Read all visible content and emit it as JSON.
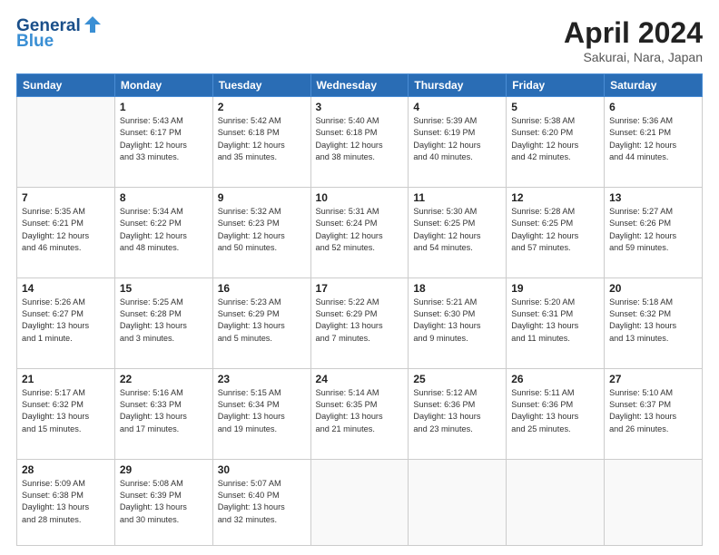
{
  "header": {
    "logo_line1": "General",
    "logo_line2": "Blue",
    "month": "April 2024",
    "location": "Sakurai, Nara, Japan"
  },
  "weekdays": [
    "Sunday",
    "Monday",
    "Tuesday",
    "Wednesday",
    "Thursday",
    "Friday",
    "Saturday"
  ],
  "weeks": [
    [
      {
        "day": "",
        "info": ""
      },
      {
        "day": "1",
        "info": "Sunrise: 5:43 AM\nSunset: 6:17 PM\nDaylight: 12 hours\nand 33 minutes."
      },
      {
        "day": "2",
        "info": "Sunrise: 5:42 AM\nSunset: 6:18 PM\nDaylight: 12 hours\nand 35 minutes."
      },
      {
        "day": "3",
        "info": "Sunrise: 5:40 AM\nSunset: 6:18 PM\nDaylight: 12 hours\nand 38 minutes."
      },
      {
        "day": "4",
        "info": "Sunrise: 5:39 AM\nSunset: 6:19 PM\nDaylight: 12 hours\nand 40 minutes."
      },
      {
        "day": "5",
        "info": "Sunrise: 5:38 AM\nSunset: 6:20 PM\nDaylight: 12 hours\nand 42 minutes."
      },
      {
        "day": "6",
        "info": "Sunrise: 5:36 AM\nSunset: 6:21 PM\nDaylight: 12 hours\nand 44 minutes."
      }
    ],
    [
      {
        "day": "7",
        "info": "Sunrise: 5:35 AM\nSunset: 6:21 PM\nDaylight: 12 hours\nand 46 minutes."
      },
      {
        "day": "8",
        "info": "Sunrise: 5:34 AM\nSunset: 6:22 PM\nDaylight: 12 hours\nand 48 minutes."
      },
      {
        "day": "9",
        "info": "Sunrise: 5:32 AM\nSunset: 6:23 PM\nDaylight: 12 hours\nand 50 minutes."
      },
      {
        "day": "10",
        "info": "Sunrise: 5:31 AM\nSunset: 6:24 PM\nDaylight: 12 hours\nand 52 minutes."
      },
      {
        "day": "11",
        "info": "Sunrise: 5:30 AM\nSunset: 6:25 PM\nDaylight: 12 hours\nand 54 minutes."
      },
      {
        "day": "12",
        "info": "Sunrise: 5:28 AM\nSunset: 6:25 PM\nDaylight: 12 hours\nand 57 minutes."
      },
      {
        "day": "13",
        "info": "Sunrise: 5:27 AM\nSunset: 6:26 PM\nDaylight: 12 hours\nand 59 minutes."
      }
    ],
    [
      {
        "day": "14",
        "info": "Sunrise: 5:26 AM\nSunset: 6:27 PM\nDaylight: 13 hours\nand 1 minute."
      },
      {
        "day": "15",
        "info": "Sunrise: 5:25 AM\nSunset: 6:28 PM\nDaylight: 13 hours\nand 3 minutes."
      },
      {
        "day": "16",
        "info": "Sunrise: 5:23 AM\nSunset: 6:29 PM\nDaylight: 13 hours\nand 5 minutes."
      },
      {
        "day": "17",
        "info": "Sunrise: 5:22 AM\nSunset: 6:29 PM\nDaylight: 13 hours\nand 7 minutes."
      },
      {
        "day": "18",
        "info": "Sunrise: 5:21 AM\nSunset: 6:30 PM\nDaylight: 13 hours\nand 9 minutes."
      },
      {
        "day": "19",
        "info": "Sunrise: 5:20 AM\nSunset: 6:31 PM\nDaylight: 13 hours\nand 11 minutes."
      },
      {
        "day": "20",
        "info": "Sunrise: 5:18 AM\nSunset: 6:32 PM\nDaylight: 13 hours\nand 13 minutes."
      }
    ],
    [
      {
        "day": "21",
        "info": "Sunrise: 5:17 AM\nSunset: 6:32 PM\nDaylight: 13 hours\nand 15 minutes."
      },
      {
        "day": "22",
        "info": "Sunrise: 5:16 AM\nSunset: 6:33 PM\nDaylight: 13 hours\nand 17 minutes."
      },
      {
        "day": "23",
        "info": "Sunrise: 5:15 AM\nSunset: 6:34 PM\nDaylight: 13 hours\nand 19 minutes."
      },
      {
        "day": "24",
        "info": "Sunrise: 5:14 AM\nSunset: 6:35 PM\nDaylight: 13 hours\nand 21 minutes."
      },
      {
        "day": "25",
        "info": "Sunrise: 5:12 AM\nSunset: 6:36 PM\nDaylight: 13 hours\nand 23 minutes."
      },
      {
        "day": "26",
        "info": "Sunrise: 5:11 AM\nSunset: 6:36 PM\nDaylight: 13 hours\nand 25 minutes."
      },
      {
        "day": "27",
        "info": "Sunrise: 5:10 AM\nSunset: 6:37 PM\nDaylight: 13 hours\nand 26 minutes."
      }
    ],
    [
      {
        "day": "28",
        "info": "Sunrise: 5:09 AM\nSunset: 6:38 PM\nDaylight: 13 hours\nand 28 minutes."
      },
      {
        "day": "29",
        "info": "Sunrise: 5:08 AM\nSunset: 6:39 PM\nDaylight: 13 hours\nand 30 minutes."
      },
      {
        "day": "30",
        "info": "Sunrise: 5:07 AM\nSunset: 6:40 PM\nDaylight: 13 hours\nand 32 minutes."
      },
      {
        "day": "",
        "info": ""
      },
      {
        "day": "",
        "info": ""
      },
      {
        "day": "",
        "info": ""
      },
      {
        "day": "",
        "info": ""
      }
    ]
  ]
}
